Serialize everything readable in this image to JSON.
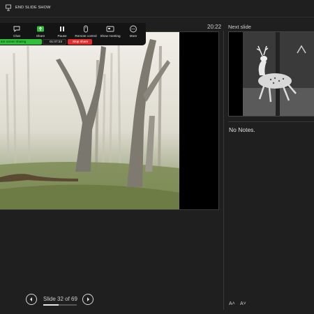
{
  "topbar": {
    "end_label": "END SLIDE SHOW",
    "end_icon": "presentation-exit-icon"
  },
  "timer": "20:22",
  "next_slide_label": "Next slide",
  "toolbar": {
    "items": [
      {
        "label": "Chat",
        "icon": "chat-icon"
      },
      {
        "label": "Share",
        "icon": "share-screen-icon"
      },
      {
        "label": "Pause",
        "icon": "pause-icon"
      },
      {
        "label": "Remote control",
        "icon": "remote-control-icon"
      },
      {
        "label": "Show meeting",
        "icon": "show-meeting-icon"
      },
      {
        "label": "More",
        "icon": "more-icon"
      }
    ],
    "sharing_text": "are screen sharing",
    "elapsed": "01:07:23",
    "stop_label": "Stop share",
    "share_color": "#2fbf3b",
    "stop_color": "#e02d2d"
  },
  "notes": "No Notes.",
  "navigation": {
    "counter": "Slide 32 of 69",
    "current": 32,
    "total": 69
  },
  "font_controls": {
    "increase": "A˄",
    "decrease": "A˅"
  }
}
